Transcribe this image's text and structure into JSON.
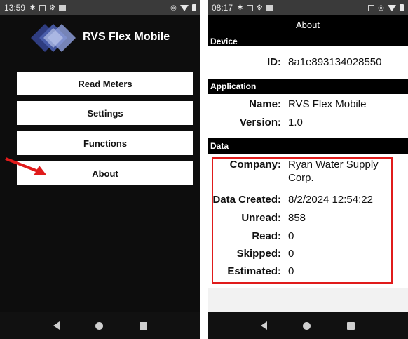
{
  "left": {
    "status": {
      "time": "13:59"
    },
    "app_title": "RVS Flex Mobile",
    "menu": [
      "Read Meters",
      "Settings",
      "Functions",
      "About"
    ]
  },
  "right": {
    "status": {
      "time": "08:17"
    },
    "title": "About",
    "sections": {
      "device": "Device",
      "application": "Application",
      "data": "Data"
    },
    "device": {
      "id_label": "ID:",
      "id_value": "8a1e893134028550"
    },
    "application": {
      "name_label": "Name:",
      "name_value": "RVS Flex Mobile",
      "version_label": "Version:",
      "version_value": "1.0"
    },
    "data": {
      "company_label": "Company:",
      "company_line1": "Ryan Water Supply",
      "company_line2": "Corp.",
      "created_label": "Data Created:",
      "created_value": "8/2/2024 12:54:22",
      "unread_label": "Unread:",
      "unread_value": "858",
      "read_label": "Read:",
      "read_value": "0",
      "skipped_label": "Skipped:",
      "skipped_value": "0",
      "estimated_label": "Estimated:",
      "estimated_value": "0"
    }
  },
  "colors": {
    "highlight": "#e01b1b",
    "annotation_arrow": "#e01b1b",
    "logo_blue": "#3d4f9a"
  }
}
